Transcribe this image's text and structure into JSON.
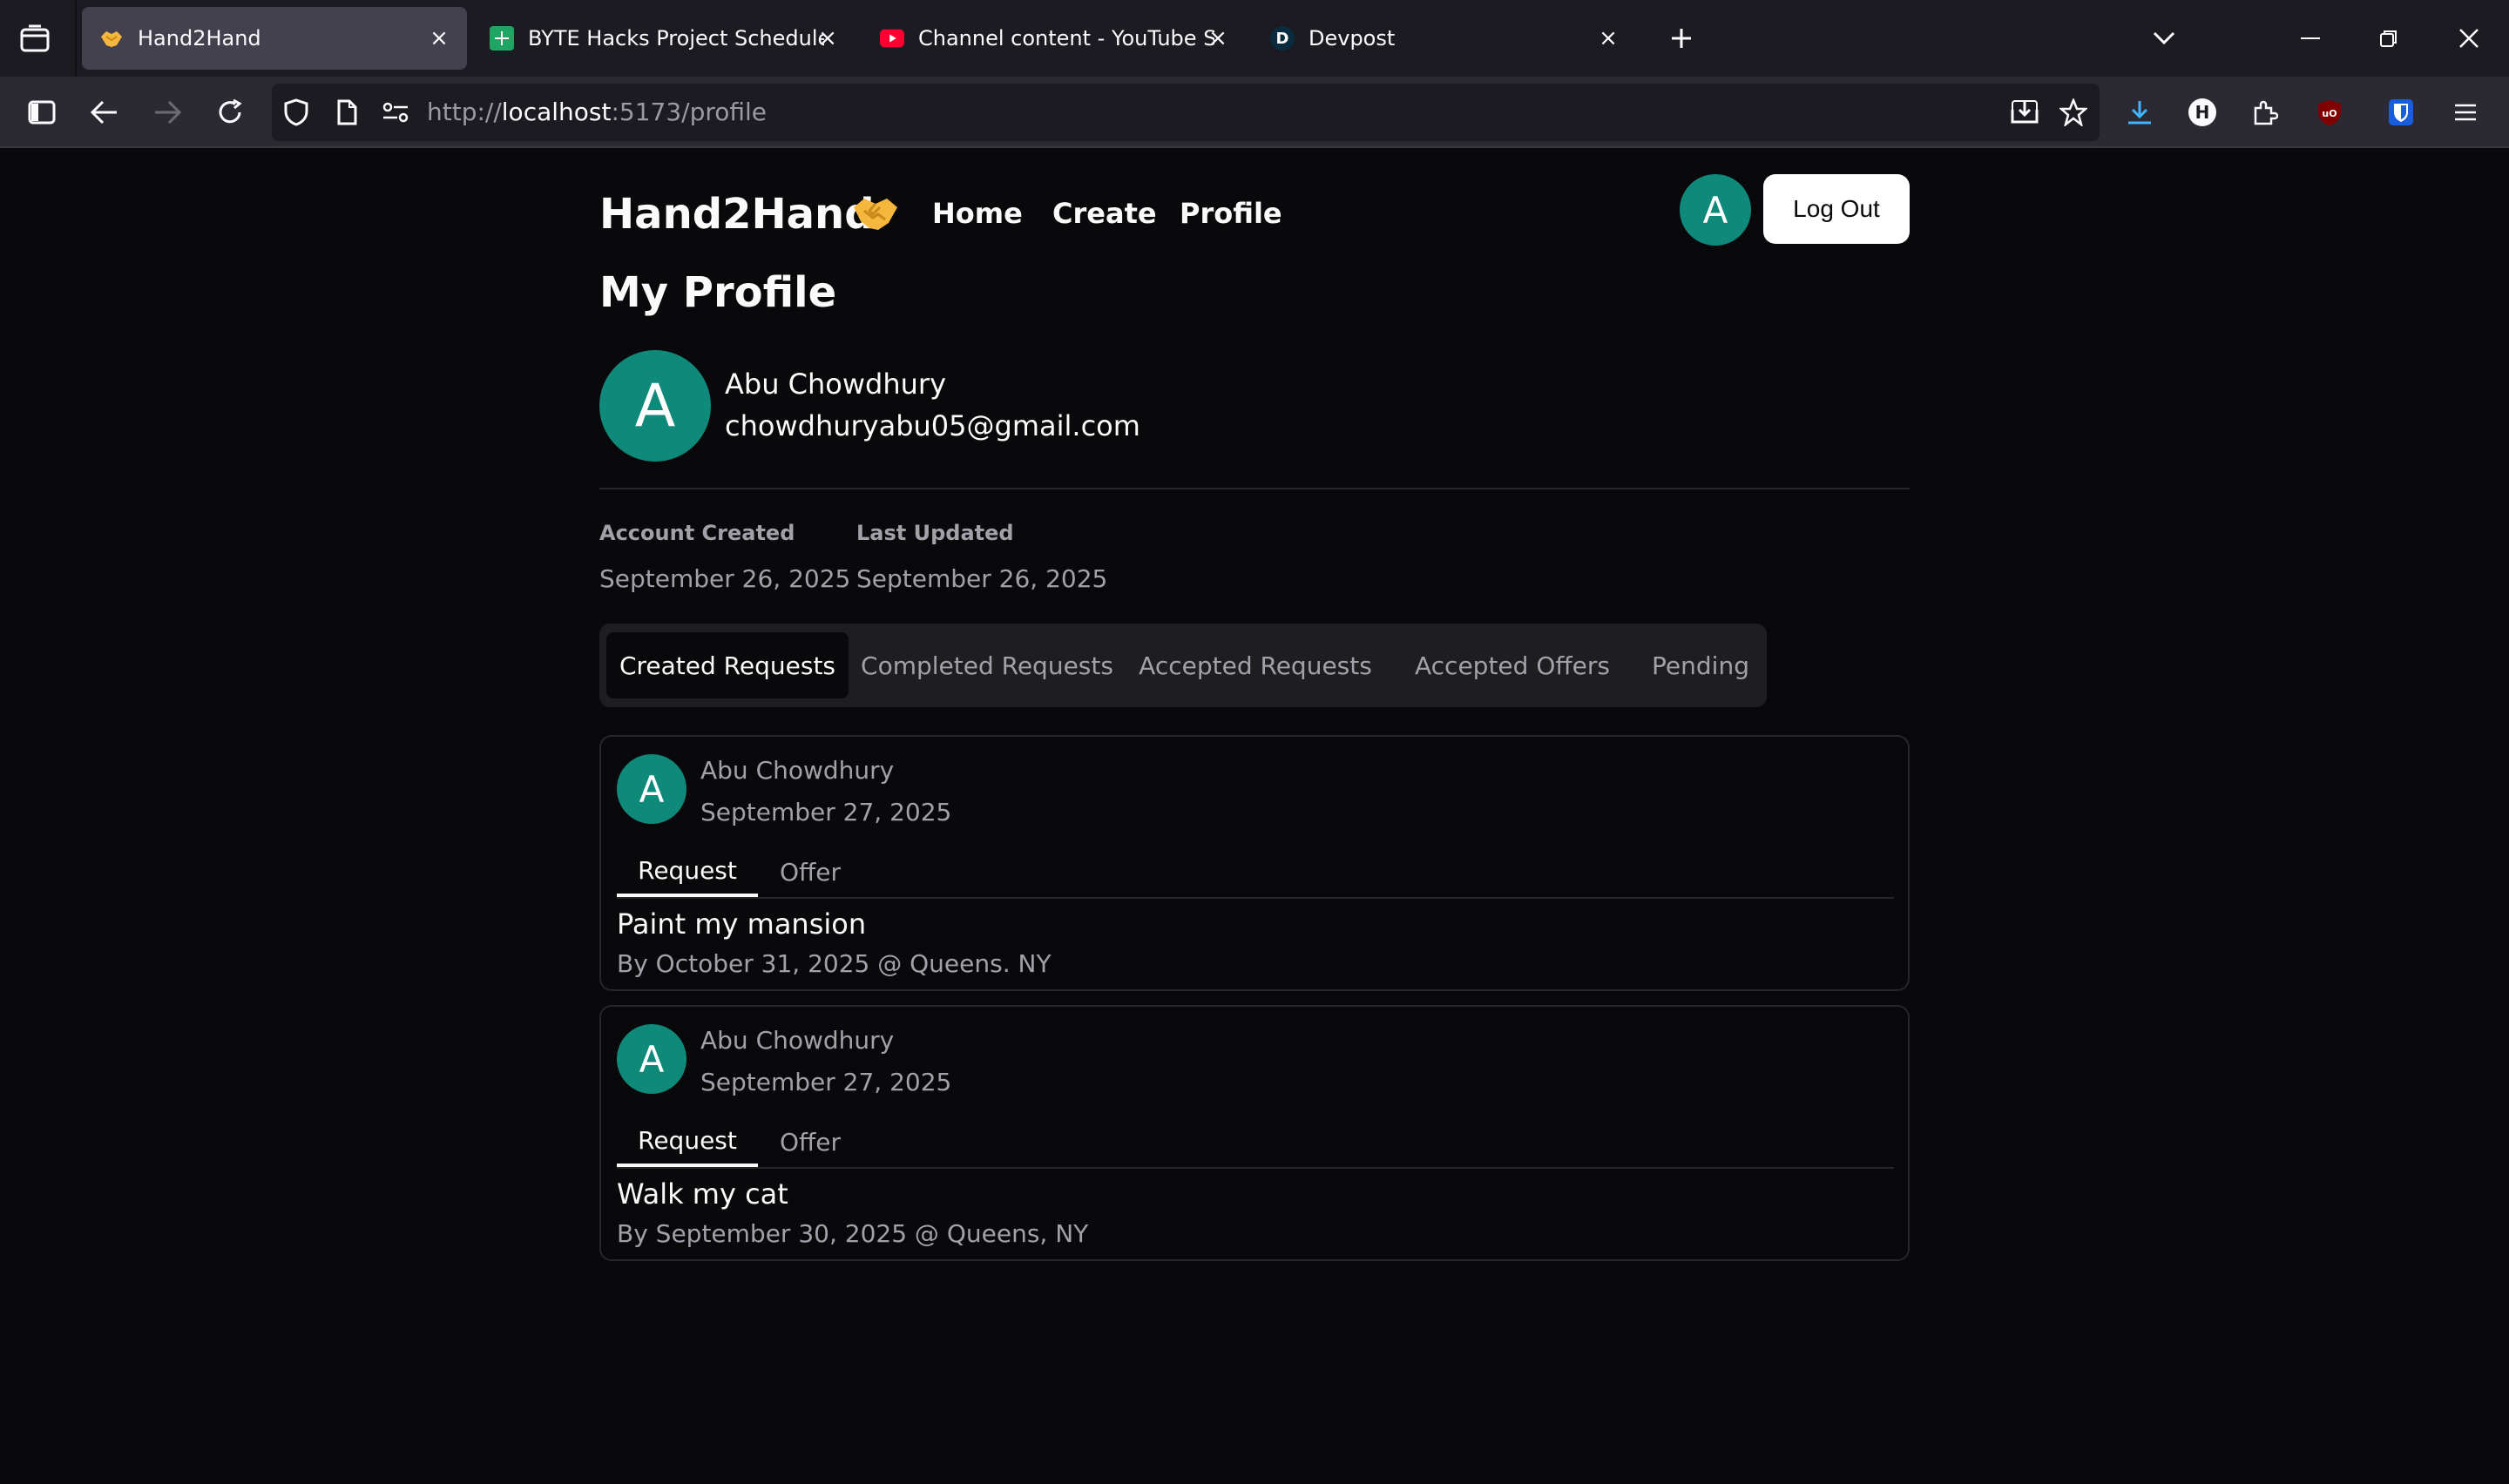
{
  "browser": {
    "tabs": [
      {
        "title": "Hand2Hand",
        "favicon": "handshake-icon"
      },
      {
        "title": "BYTE Hacks Project Schedule - G",
        "favicon": "sheets-icon"
      },
      {
        "title": "Channel content - YouTube Stu",
        "favicon": "youtube-icon"
      },
      {
        "title": "Devpost",
        "favicon": "devpost-icon",
        "favicon_letter": "D"
      }
    ],
    "url": {
      "scheme": "http://",
      "host": "localhost",
      "rest": ":5173/profile"
    }
  },
  "app": {
    "brand": "Hand2Hand",
    "nav": [
      "Home",
      "Create",
      "Profile"
    ],
    "user_initial": "A",
    "logout_label": "Log Out"
  },
  "profile": {
    "title": "My Profile",
    "initial": "A",
    "name": "Abu Chowdhury",
    "email": "chowdhuryabu05@gmail.com",
    "created_label": "Account Created",
    "created_value": "September 26, 2025",
    "updated_label": "Last Updated",
    "updated_value": "September 26, 2025"
  },
  "tabs": [
    "Created Requests",
    "Completed Requests",
    "Accepted Requests",
    "Accepted Offers",
    "Pending"
  ],
  "cards": [
    {
      "initial": "A",
      "name": "Abu Chowdhury",
      "date": "September 27, 2025",
      "tab_request": "Request",
      "tab_offer": "Offer",
      "title": "Paint my mansion",
      "subtitle": "By October 31, 2025 @ Queens. NY"
    },
    {
      "initial": "A",
      "name": "Abu Chowdhury",
      "date": "September 27, 2025",
      "tab_request": "Request",
      "tab_offer": "Offer",
      "title": "Walk my cat",
      "subtitle": "By September 30, 2025 @ Queens, NY"
    }
  ],
  "colors": {
    "accent": "#0f8a7a",
    "background": "#09090b",
    "muted": "#a1a1aa"
  }
}
